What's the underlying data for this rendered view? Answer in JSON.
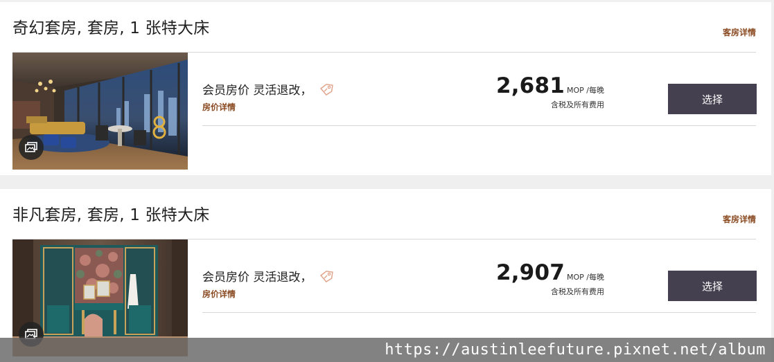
{
  "rooms": [
    {
      "title": "奇幻套房, 套房, 1 张特大床",
      "room_details_label": "客房详情",
      "photo_icon": "gallery-icon",
      "rate": {
        "name": "会员房价 灵活退改，",
        "tag_icon": "tag-icon",
        "details_label": "房价详情",
        "price": "2,681",
        "unit": "MOP /每晚",
        "note": "含税及所有费用",
        "select_label": "选择"
      }
    },
    {
      "title": "非凡套房, 套房, 1 张特大床",
      "room_details_label": "客房详情",
      "photo_icon": "gallery-icon",
      "rate": {
        "name": "会员房价 灵活退改，",
        "tag_icon": "tag-icon",
        "details_label": "房价详情",
        "price": "2,907",
        "unit": "MOP /每晚",
        "note": "含税及所有费用",
        "select_label": "选择"
      }
    }
  ],
  "watermark": "https://austinleefuture.pixnet.net/album",
  "colors": {
    "accent_link": "#8a4b22",
    "select_button": "#45404f",
    "tag_icon": "#e0a48a"
  }
}
